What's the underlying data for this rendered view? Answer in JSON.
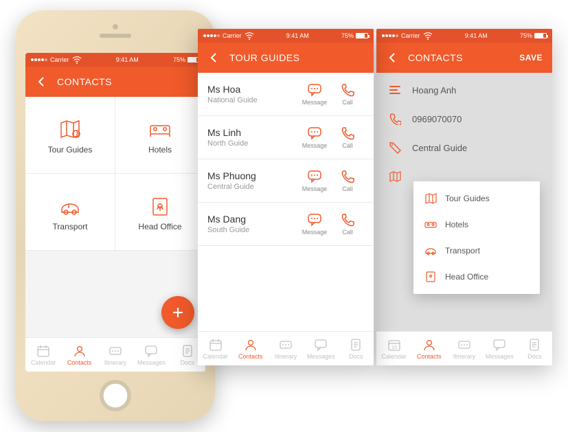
{
  "status": {
    "carrier": "Carrier",
    "time": "9:41 AM",
    "battery": "75%"
  },
  "screen1": {
    "title": "CONTACTS",
    "categories": [
      {
        "label": "Tour Guides"
      },
      {
        "label": "Hotels"
      },
      {
        "label": "Transport"
      },
      {
        "label": "Head Office"
      }
    ]
  },
  "screen2": {
    "title": "TOUR GUIDES",
    "action_message": "Message",
    "action_call": "Call",
    "guides": [
      {
        "name": "Ms Hoa",
        "role": "National Guide"
      },
      {
        "name": "Ms Linh",
        "role": "North Guide"
      },
      {
        "name": "Ms Phuong",
        "role": "Central Guide"
      },
      {
        "name": "Ms Dang",
        "role": "South Guide"
      }
    ]
  },
  "screen3": {
    "title": "CONTACTS",
    "save": "SAVE",
    "name": "Hoang Anh",
    "phone": "0969070070",
    "role": "Central Guide",
    "dropdown": [
      {
        "label": "Tour Guides"
      },
      {
        "label": "Hotels"
      },
      {
        "label": "Transport"
      },
      {
        "label": "Head Office"
      }
    ]
  },
  "tabs": [
    {
      "label": "Calendar"
    },
    {
      "label": "Contacts"
    },
    {
      "label": "Itinerary"
    },
    {
      "label": "Messages"
    },
    {
      "label": "Docs"
    }
  ]
}
